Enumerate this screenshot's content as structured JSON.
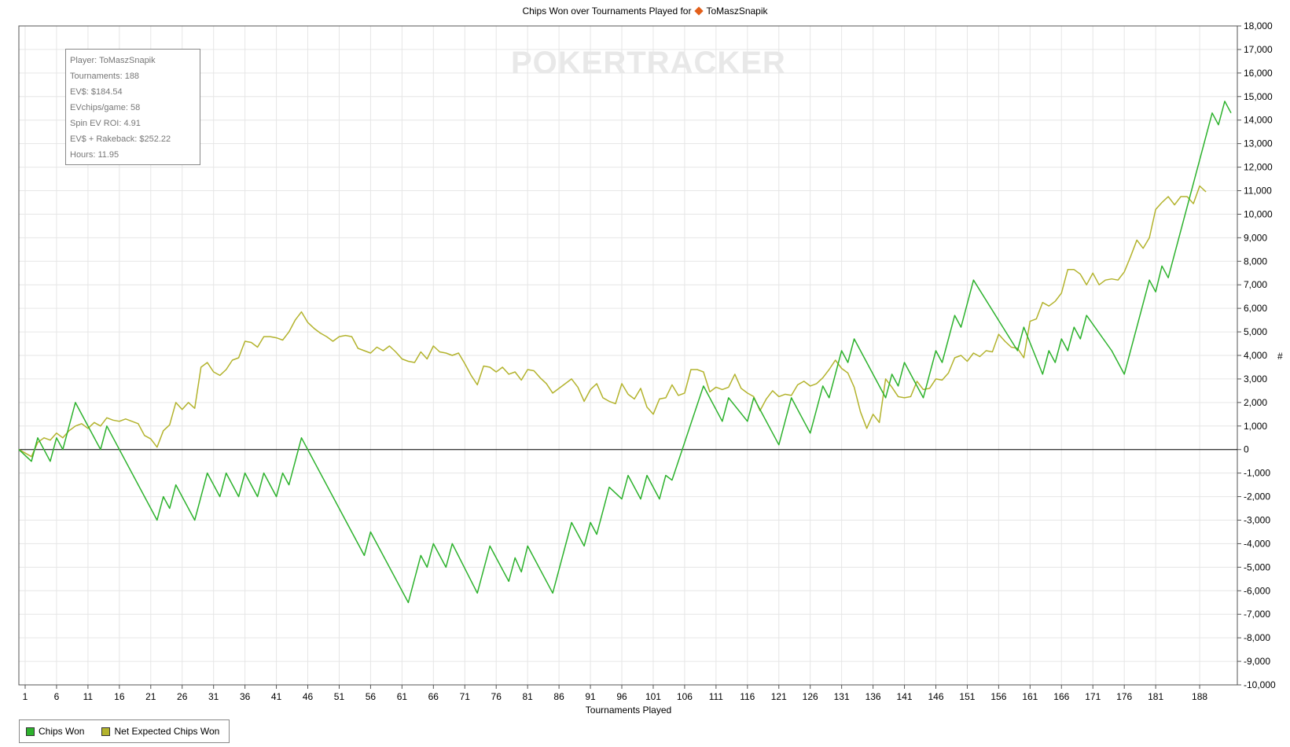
{
  "title": {
    "text": "Chips Won over Tournaments Played for",
    "player": "ToMaszSnapik"
  },
  "watermark": "POKERTRACKER",
  "stats": {
    "player": "Player: ToMaszSnapik",
    "tournaments": "Tournaments: 188",
    "evs": "EV$: $184.54",
    "evchips": "EVchips/game: 58",
    "spin_roi": "Spin EV ROI: 4.91",
    "ev_rakeback": "EV$ + Rakeback: $252.22",
    "hours": "Hours: 11.95"
  },
  "colors": {
    "chips_won": "#2db22d",
    "net_expected": "#b3b32d",
    "grid": "#e6e6e6"
  },
  "chart_data": {
    "type": "line",
    "xlabel": "Tournaments Played",
    "ylabel": "#",
    "xlim": [
      1,
      188
    ],
    "ylim": [
      -10000,
      18000
    ],
    "y_ticks": [
      -10000,
      -9000,
      -8000,
      -7000,
      -6000,
      -5000,
      -4000,
      -3000,
      -2000,
      -1000,
      0,
      1000,
      2000,
      3000,
      4000,
      5000,
      6000,
      7000,
      8000,
      9000,
      10000,
      11000,
      12000,
      13000,
      14000,
      15000,
      16000,
      17000,
      18000
    ],
    "y_tick_labels": [
      "-10,000",
      "-9,000",
      "-8,000",
      "-7,000",
      "-6,000",
      "-5,000",
      "-4,000",
      "-3,000",
      "-2,000",
      "-1,000",
      "0",
      "1,000",
      "2,000",
      "3,000",
      "4,000",
      "5,000",
      "6,000",
      "7,000",
      "8,000",
      "9,000",
      "10,000",
      "11,000",
      "12,000",
      "13,000",
      "14,000",
      "15,000",
      "16,000",
      "17,000",
      "18,000"
    ],
    "x_ticks": [
      1,
      6,
      11,
      16,
      21,
      26,
      31,
      36,
      41,
      46,
      51,
      56,
      61,
      66,
      71,
      76,
      81,
      86,
      91,
      96,
      101,
      106,
      111,
      116,
      121,
      126,
      131,
      136,
      141,
      146,
      151,
      156,
      161,
      166,
      171,
      176,
      181,
      188
    ],
    "grid": true,
    "legend_position": "bottom-left",
    "series": [
      {
        "name": "Chips Won",
        "points": [
          [
            0,
            0
          ],
          [
            2,
            -500
          ],
          [
            3,
            500
          ],
          [
            5,
            -500
          ],
          [
            6,
            500
          ],
          [
            7,
            0
          ],
          [
            9,
            2000
          ],
          [
            13,
            0
          ],
          [
            14,
            1000
          ],
          [
            22,
            -3000
          ],
          [
            23,
            -2000
          ],
          [
            24,
            -2500
          ],
          [
            25,
            -1500
          ],
          [
            28,
            -3000
          ],
          [
            30,
            -1000
          ],
          [
            32,
            -2000
          ],
          [
            33,
            -1000
          ],
          [
            35,
            -2000
          ],
          [
            36,
            -1000
          ],
          [
            38,
            -2000
          ],
          [
            39,
            -1000
          ],
          [
            41,
            -2000
          ],
          [
            42,
            -1000
          ],
          [
            43,
            -1500
          ],
          [
            45,
            500
          ],
          [
            55,
            -4500
          ],
          [
            56,
            -3500
          ],
          [
            62,
            -6500
          ],
          [
            64,
            -4500
          ],
          [
            65,
            -5000
          ],
          [
            66,
            -4000
          ],
          [
            68,
            -5000
          ],
          [
            69,
            -4000
          ],
          [
            73,
            -6100
          ],
          [
            75,
            -4100
          ],
          [
            78,
            -5600
          ],
          [
            79,
            -4600
          ],
          [
            80,
            -5200
          ],
          [
            81,
            -4100
          ],
          [
            85,
            -6100
          ],
          [
            88,
            -3100
          ],
          [
            90,
            -4100
          ],
          [
            91,
            -3100
          ],
          [
            92,
            -3600
          ],
          [
            94,
            -1600
          ],
          [
            96,
            -2100
          ],
          [
            97,
            -1100
          ],
          [
            99,
            -2100
          ],
          [
            100,
            -1100
          ],
          [
            102,
            -2100
          ],
          [
            103,
            -1100
          ],
          [
            104,
            -1300
          ],
          [
            109,
            2700
          ],
          [
            112,
            1200
          ],
          [
            113,
            2200
          ],
          [
            116,
            1200
          ],
          [
            117,
            2200
          ],
          [
            121,
            200
          ],
          [
            123,
            2200
          ],
          [
            126,
            700
          ],
          [
            128,
            2700
          ],
          [
            129,
            2200
          ],
          [
            131,
            4200
          ],
          [
            132,
            3700
          ],
          [
            133,
            4700
          ],
          [
            138,
            2200
          ],
          [
            139,
            3200
          ],
          [
            140,
            2700
          ],
          [
            141,
            3700
          ],
          [
            144,
            2200
          ],
          [
            146,
            4200
          ],
          [
            147,
            3700
          ],
          [
            149,
            5700
          ],
          [
            150,
            5200
          ],
          [
            152,
            7200
          ],
          [
            159,
            4200
          ],
          [
            160,
            5200
          ],
          [
            163,
            3200
          ],
          [
            164,
            4200
          ],
          [
            165,
            3700
          ],
          [
            166,
            4700
          ],
          [
            167,
            4200
          ],
          [
            168,
            5200
          ],
          [
            169,
            4700
          ],
          [
            170,
            5700
          ],
          [
            174,
            4200
          ],
          [
            176,
            3200
          ],
          [
            180,
            7200
          ],
          [
            181,
            6700
          ],
          [
            182,
            7800
          ],
          [
            183,
            7300
          ],
          [
            190,
            14300
          ],
          [
            191,
            13800
          ],
          [
            192,
            14800
          ],
          [
            193,
            14300
          ]
        ]
      },
      {
        "name": "Net Expected Chips Won",
        "points": [
          [
            0,
            0
          ],
          [
            2,
            -300
          ],
          [
            3,
            300
          ],
          [
            4,
            500
          ],
          [
            5,
            400
          ],
          [
            6,
            700
          ],
          [
            7,
            500
          ],
          [
            8,
            800
          ],
          [
            9,
            1000
          ],
          [
            10,
            1100
          ],
          [
            11,
            900
          ],
          [
            12,
            1150
          ],
          [
            13,
            1000
          ],
          [
            14,
            1350
          ],
          [
            15,
            1250
          ],
          [
            16,
            1200
          ],
          [
            17,
            1300
          ],
          [
            18,
            1200
          ],
          [
            19,
            1100
          ],
          [
            20,
            600
          ],
          [
            21,
            450
          ],
          [
            22,
            100
          ],
          [
            23,
            800
          ],
          [
            24,
            1050
          ],
          [
            25,
            2000
          ],
          [
            26,
            1700
          ],
          [
            27,
            2000
          ],
          [
            28,
            1750
          ],
          [
            29,
            3500
          ],
          [
            30,
            3700
          ],
          [
            31,
            3300
          ],
          [
            32,
            3150
          ],
          [
            33,
            3400
          ],
          [
            34,
            3800
          ],
          [
            35,
            3900
          ],
          [
            36,
            4600
          ],
          [
            37,
            4550
          ],
          [
            38,
            4350
          ],
          [
            39,
            4800
          ],
          [
            40,
            4800
          ],
          [
            41,
            4750
          ],
          [
            42,
            4650
          ],
          [
            43,
            5000
          ],
          [
            44,
            5500
          ],
          [
            45,
            5850
          ],
          [
            46,
            5400
          ],
          [
            47,
            5150
          ],
          [
            48,
            4950
          ],
          [
            49,
            4800
          ],
          [
            50,
            4600
          ],
          [
            51,
            4800
          ],
          [
            52,
            4850
          ],
          [
            53,
            4800
          ],
          [
            54,
            4300
          ],
          [
            55,
            4200
          ],
          [
            56,
            4100
          ],
          [
            57,
            4350
          ],
          [
            58,
            4200
          ],
          [
            59,
            4400
          ],
          [
            60,
            4150
          ],
          [
            61,
            3850
          ],
          [
            62,
            3750
          ],
          [
            63,
            3700
          ],
          [
            64,
            4150
          ],
          [
            65,
            3850
          ],
          [
            66,
            4400
          ],
          [
            67,
            4150
          ],
          [
            68,
            4100
          ],
          [
            69,
            4000
          ],
          [
            70,
            4100
          ],
          [
            71,
            3650
          ],
          [
            72,
            3150
          ],
          [
            73,
            2750
          ],
          [
            74,
            3550
          ],
          [
            75,
            3500
          ],
          [
            76,
            3300
          ],
          [
            77,
            3500
          ],
          [
            78,
            3200
          ],
          [
            79,
            3300
          ],
          [
            80,
            2950
          ],
          [
            81,
            3400
          ],
          [
            82,
            3350
          ],
          [
            83,
            3050
          ],
          [
            84,
            2800
          ],
          [
            85,
            2400
          ],
          [
            86,
            2600
          ],
          [
            87,
            2800
          ],
          [
            88,
            3000
          ],
          [
            89,
            2650
          ],
          [
            90,
            2050
          ],
          [
            91,
            2550
          ],
          [
            92,
            2800
          ],
          [
            93,
            2200
          ],
          [
            94,
            2050
          ],
          [
            95,
            1950
          ],
          [
            96,
            2800
          ],
          [
            97,
            2350
          ],
          [
            98,
            2150
          ],
          [
            99,
            2600
          ],
          [
            100,
            1800
          ],
          [
            101,
            1500
          ],
          [
            102,
            2150
          ],
          [
            103,
            2200
          ],
          [
            104,
            2750
          ],
          [
            105,
            2300
          ],
          [
            106,
            2400
          ],
          [
            107,
            3400
          ],
          [
            108,
            3400
          ],
          [
            109,
            3300
          ],
          [
            110,
            2450
          ],
          [
            111,
            2650
          ],
          [
            112,
            2550
          ],
          [
            113,
            2650
          ],
          [
            114,
            3200
          ],
          [
            115,
            2600
          ],
          [
            116,
            2400
          ],
          [
            117,
            2250
          ],
          [
            118,
            1650
          ],
          [
            119,
            2150
          ],
          [
            120,
            2500
          ],
          [
            121,
            2250
          ],
          [
            122,
            2350
          ],
          [
            123,
            2300
          ],
          [
            124,
            2750
          ],
          [
            125,
            2900
          ],
          [
            126,
            2700
          ],
          [
            127,
            2800
          ],
          [
            128,
            3050
          ],
          [
            129,
            3400
          ],
          [
            130,
            3800
          ],
          [
            131,
            3450
          ],
          [
            132,
            3250
          ],
          [
            133,
            2650
          ],
          [
            134,
            1600
          ],
          [
            135,
            900
          ],
          [
            136,
            1500
          ],
          [
            137,
            1150
          ],
          [
            138,
            3000
          ],
          [
            139,
            2650
          ],
          [
            140,
            2250
          ],
          [
            141,
            2200
          ],
          [
            142,
            2250
          ],
          [
            143,
            2900
          ],
          [
            144,
            2550
          ],
          [
            145,
            2600
          ],
          [
            146,
            3000
          ],
          [
            147,
            2950
          ],
          [
            148,
            3250
          ],
          [
            149,
            3900
          ],
          [
            150,
            4000
          ],
          [
            151,
            3750
          ],
          [
            152,
            4100
          ],
          [
            153,
            3950
          ],
          [
            154,
            4200
          ],
          [
            155,
            4150
          ],
          [
            156,
            4900
          ],
          [
            157,
            4600
          ],
          [
            158,
            4350
          ],
          [
            159,
            4300
          ],
          [
            160,
            3900
          ],
          [
            161,
            5450
          ],
          [
            162,
            5550
          ],
          [
            163,
            6250
          ],
          [
            164,
            6100
          ],
          [
            165,
            6300
          ],
          [
            166,
            6650
          ],
          [
            167,
            7650
          ],
          [
            168,
            7650
          ],
          [
            169,
            7450
          ],
          [
            170,
            7000
          ],
          [
            171,
            7500
          ],
          [
            172,
            7000
          ],
          [
            173,
            7200
          ],
          [
            174,
            7250
          ],
          [
            175,
            7200
          ],
          [
            176,
            7550
          ],
          [
            177,
            8200
          ],
          [
            178,
            8900
          ],
          [
            179,
            8550
          ],
          [
            180,
            9000
          ],
          [
            181,
            10200
          ],
          [
            182,
            10500
          ],
          [
            183,
            10750
          ],
          [
            184,
            10400
          ],
          [
            185,
            10750
          ],
          [
            186,
            10750
          ],
          [
            187,
            10450
          ],
          [
            188,
            11200
          ],
          [
            189,
            10950
          ]
        ]
      }
    ]
  },
  "legend": {
    "chips_won": "Chips Won",
    "net_expected": "Net Expected Chips Won"
  }
}
